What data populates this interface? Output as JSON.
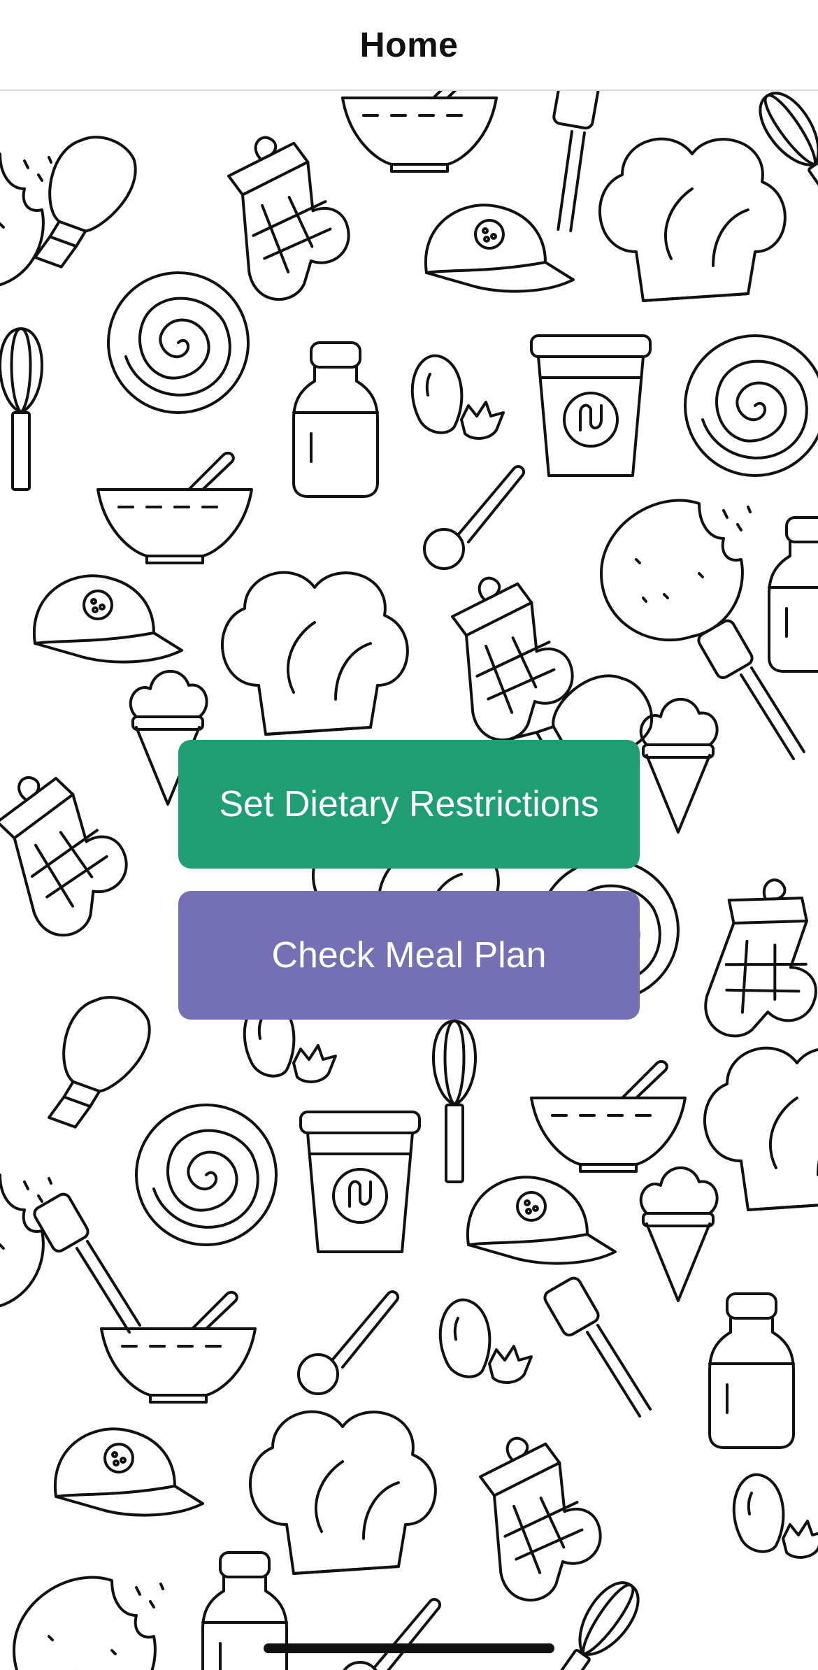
{
  "nav": {
    "title": "Home"
  },
  "background": {
    "pattern": "kitchen-doodles",
    "line_color": "#111111",
    "fill_color": "#ffffff"
  },
  "actions": {
    "set_dietary_label": "Set Dietary Restrictions",
    "set_dietary_color": "#1f9e73",
    "check_meal_plan_label": "Check Meal Plan",
    "check_meal_plan_color": "#7570b3"
  }
}
